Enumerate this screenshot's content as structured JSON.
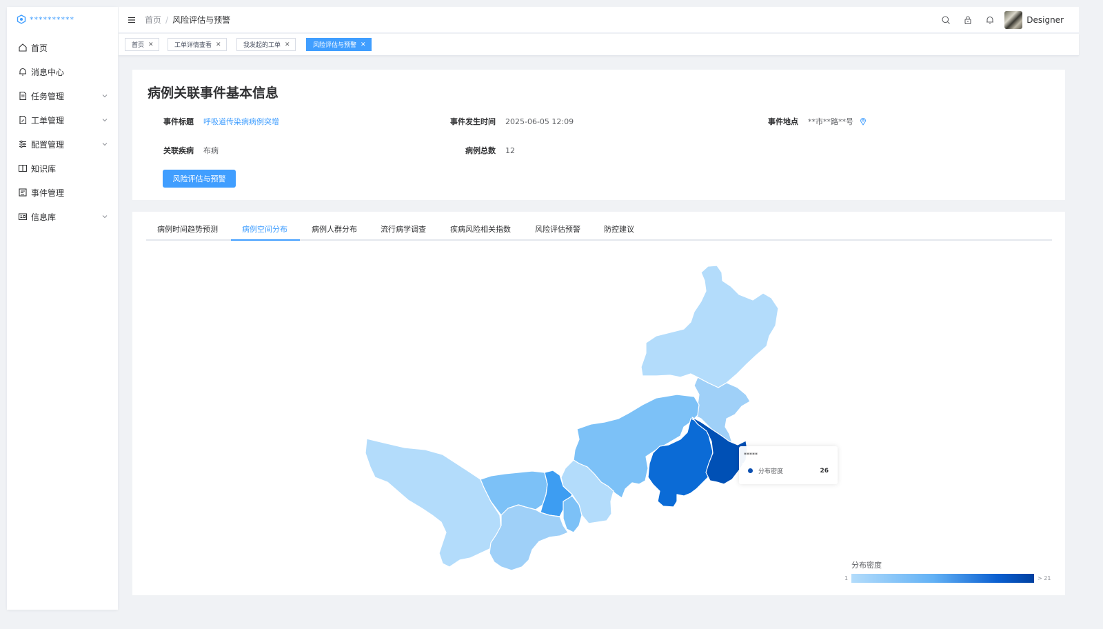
{
  "app": {
    "logo_text": "**********"
  },
  "sidebar": {
    "items": [
      {
        "label": "首页",
        "icon": "home-icon",
        "expandable": false
      },
      {
        "label": "消息中心",
        "icon": "bell-icon",
        "expandable": false
      },
      {
        "label": "任务管理",
        "icon": "document-icon",
        "expandable": true
      },
      {
        "label": "工单管理",
        "icon": "edit-document-icon",
        "expandable": true
      },
      {
        "label": "配置管理",
        "icon": "sliders-icon",
        "expandable": true
      },
      {
        "label": "知识库",
        "icon": "book-icon",
        "expandable": false
      },
      {
        "label": "事件管理",
        "icon": "calendar-icon",
        "expandable": false
      },
      {
        "label": "信息库",
        "icon": "id-card-icon",
        "expandable": true
      }
    ]
  },
  "header": {
    "breadcrumb": {
      "home": "首页",
      "separator": "/",
      "current": "风险评估与预警"
    },
    "username": "Designer"
  },
  "tags": [
    {
      "label": "首页",
      "active": false
    },
    {
      "label": "工单详情查看",
      "active": false
    },
    {
      "label": "我发起的工单",
      "active": false
    },
    {
      "label": "风险评估与预警",
      "active": true
    }
  ],
  "info": {
    "title": "病例关联事件基本信息",
    "event_title_label": "事件标题",
    "event_title_value": "呼吸道传染病病例突增",
    "time_label": "事件发生时间",
    "time_value": "2025-06-05 12:09",
    "location_label": "事件地点",
    "location_value": "**市**路**号",
    "disease_label": "关联疾病",
    "disease_value": "布病",
    "total_label": "病例总数",
    "total_value": "12",
    "button_label": "风险评估与预警"
  },
  "tabs": [
    {
      "label": "病例时间趋势预测",
      "active": false
    },
    {
      "label": "病例空间分布",
      "active": true
    },
    {
      "label": "病例人群分布",
      "active": false
    },
    {
      "label": "流行病学调查",
      "active": false
    },
    {
      "label": "疾病风险相关指数",
      "active": false
    },
    {
      "label": "风险评估预警",
      "active": false
    },
    {
      "label": "防控建议",
      "active": false
    }
  ],
  "map": {
    "tooltip": {
      "title": "*****",
      "series": "分布密度",
      "value": "26"
    },
    "legend": {
      "title": "分布密度",
      "min": "1",
      "max": "> 21"
    },
    "colors": {
      "lightest": "#b3dcfb",
      "light": "#9fd0f8",
      "mid": "#7cc1f7",
      "medium": "#5cb0f5",
      "strong": "#3d9df2",
      "dark": "#0b6bd6",
      "darkest": "#0050b5"
    }
  }
}
